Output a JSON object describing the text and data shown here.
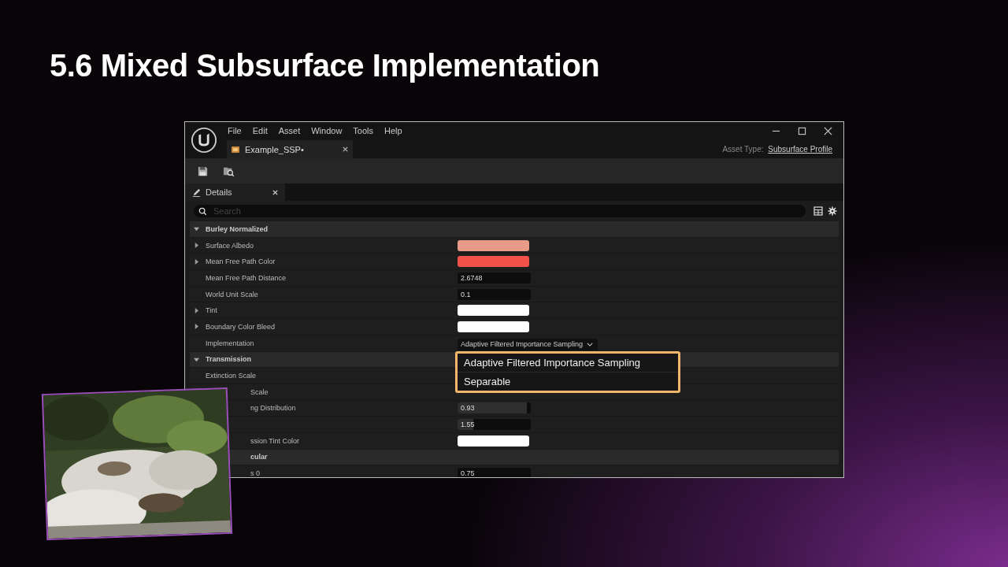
{
  "slide_title": "5.6 Mixed Subsurface Implementation",
  "window": {
    "menu": [
      "File",
      "Edit",
      "Asset",
      "Window",
      "Tools",
      "Help"
    ],
    "document_tab": {
      "label": "Example_SSP•"
    },
    "asset_type": {
      "label": "Asset Type:",
      "value": "Subsurface Profile"
    },
    "panel_tab": {
      "label": "Details"
    },
    "search": {
      "placeholder": "Search"
    },
    "rows": [
      {
        "kind": "section",
        "label": "Burley Normalized",
        "expanded": true
      },
      {
        "kind": "color",
        "label": "Surface Albedo",
        "expanded": false,
        "color": "#e99b8a"
      },
      {
        "kind": "color",
        "label": "Mean Free Path Color",
        "expanded": false,
        "color": "#f0524a"
      },
      {
        "kind": "number",
        "label": "Mean Free Path Distance",
        "value": "2.6748"
      },
      {
        "kind": "number",
        "label": "World Unit Scale",
        "value": "0.1"
      },
      {
        "kind": "color",
        "label": "Tint",
        "expanded": false,
        "color": "#ffffff"
      },
      {
        "kind": "color",
        "label": "Boundary Color Bleed",
        "expanded": false,
        "color": "#ffffff"
      },
      {
        "kind": "dropdown",
        "label": "Implementation",
        "value": "Adaptive Filtered Importance Sampling"
      },
      {
        "kind": "section",
        "label": "Transmission",
        "expanded": true
      },
      {
        "kind": "hidden",
        "label": "Extinction Scale"
      },
      {
        "kind": "hidden",
        "label": "Scale",
        "cut": true
      },
      {
        "kind": "number",
        "label": "ng Distribution",
        "value": "0.93",
        "level": 0.95,
        "cut": true
      },
      {
        "kind": "number",
        "value": "1.55",
        "level": 0.22
      },
      {
        "kind": "color",
        "label": "ssion Tint Color",
        "color": "#ffffff",
        "cut": true
      },
      {
        "kind": "section",
        "label": "cular",
        "cut": true
      },
      {
        "kind": "number",
        "label": "s 0",
        "value": "0.75",
        "cut": true
      }
    ],
    "dropdown_menu": {
      "options": [
        "Adaptive Filtered Importance Sampling",
        "Separable"
      ]
    }
  }
}
